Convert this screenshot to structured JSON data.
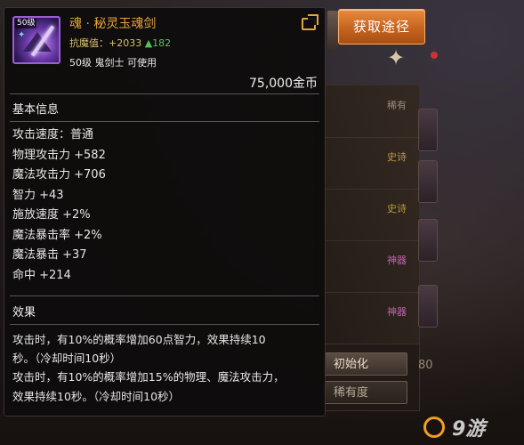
{
  "item": {
    "level_badge": "50级",
    "name": "魂 · 秘灵玉魂剑",
    "resist_label": "抗魔值：",
    "resist_value": "+2033",
    "resist_bonus": "▲182",
    "class_req": "50级 鬼剑士 可使用",
    "price": "75,000金币"
  },
  "sections": {
    "basic_title": "基本信息",
    "effect_title": "效果"
  },
  "stats": [
    "攻击速度：普通",
    "物理攻击力 +582",
    "魔法攻击力 +706",
    "智力 +43",
    "施放速度 +2%",
    "魔法暴击率 +2%",
    "魔法暴击 +37",
    "命中 +214"
  ],
  "effect_lines": [
    "攻击时，有10%的概率增加60点智力，效果持续10",
    "秒。（冷却时间10秒）",
    "攻击时，有10%的概率增加15%的物理、魔法攻击力，",
    "效果持续10秒。（冷却时间10秒）"
  ],
  "acquire_button": "获取途径",
  "background": {
    "row_tags": [
      "稀有",
      "史诗",
      "史诗",
      "神器",
      "神器"
    ],
    "tab_active": "初始化",
    "tab_inactive": "稀有度",
    "tab_number": "80",
    "watermark": "9游"
  },
  "colors": {
    "item_name": "#e6a53a",
    "resist": "#d8c070",
    "resist_bonus": "#58c060",
    "button": "#c5641f"
  }
}
